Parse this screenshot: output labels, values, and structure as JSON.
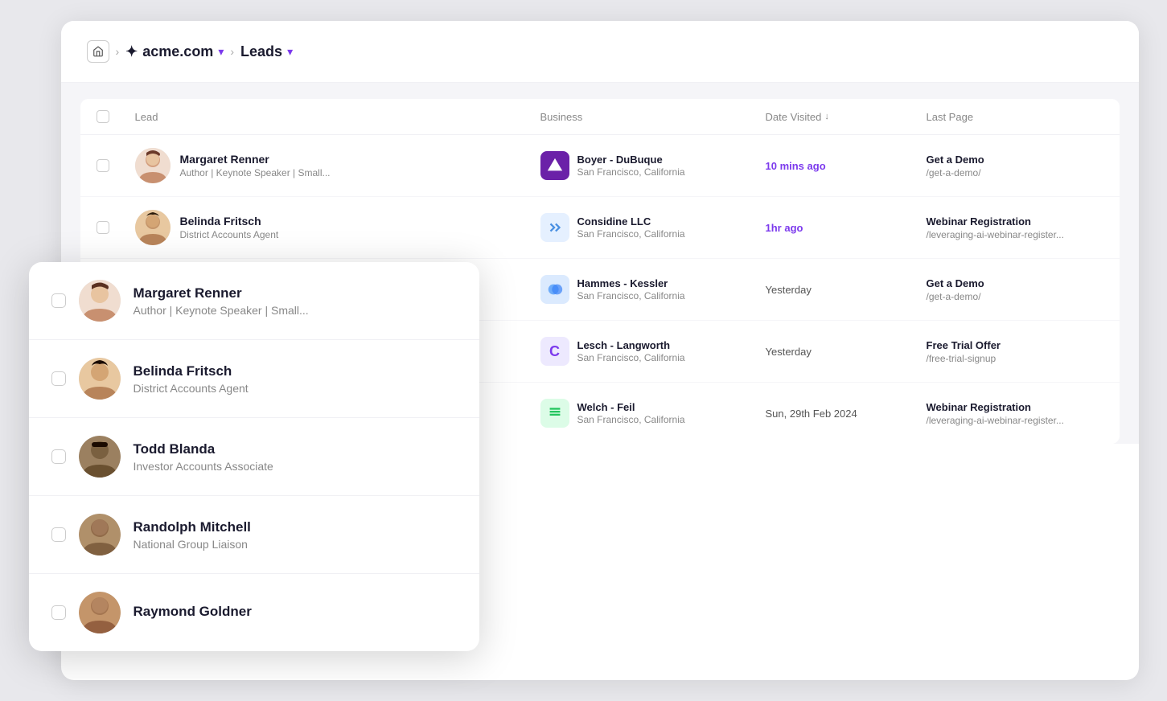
{
  "breadcrumb": {
    "home_icon": "⌂",
    "separator": ">",
    "company_name": "acme.com",
    "company_chevron": "▾",
    "page_name": "Leads",
    "page_chevron": "▾"
  },
  "table": {
    "columns": [
      {
        "id": "checkbox",
        "label": ""
      },
      {
        "id": "lead",
        "label": "Lead"
      },
      {
        "id": "business",
        "label": "Business"
      },
      {
        "id": "date_visited",
        "label": "Date Visited",
        "sortable": true
      },
      {
        "id": "last_page",
        "label": "Last Page"
      }
    ],
    "rows": [
      {
        "lead_name": "Margaret Renner",
        "lead_title": "Author | Keynote Speaker | Small...",
        "avatar_color": "#f5e6d8",
        "business_name": "Boyer - DuBuque",
        "business_location": "San Francisco, California",
        "business_logo_color": "#6b21a8",
        "business_logo_icon": "◆",
        "date_visited": "10 mins ago",
        "date_highlight": true,
        "last_page_label": "Get a Demo",
        "last_page_url": "/get-a-demo/"
      },
      {
        "lead_name": "Belinda Fritsch",
        "lead_title": "District Accounts Agent",
        "avatar_color": "#d4a574",
        "business_name": "Considine LLC",
        "business_location": "San Francisco, California",
        "business_logo_color": "#e5f0ff",
        "business_logo_icon": "⚡",
        "date_visited": "1hr ago",
        "date_highlight": true,
        "last_page_label": "Webinar Registration",
        "last_page_url": "/leveraging-ai-webinar-register..."
      },
      {
        "lead_name": "Todd Blanda",
        "lead_title": "Investor Accounts Associate",
        "avatar_color": "#8B6914",
        "business_name": "Hammes - Kessler",
        "business_location": "San Francisco, California",
        "business_logo_color": "#dbeafe",
        "business_logo_icon": "●",
        "date_visited": "Yesterday",
        "date_highlight": false,
        "last_page_label": "Get a Demo",
        "last_page_url": "/get-a-demo/"
      },
      {
        "lead_name": "Randolph Mitchell",
        "lead_title": "National Group Liaison",
        "avatar_color": "#9B8060",
        "business_name": "Lesch - Langworth",
        "business_location": "San Francisco, California",
        "business_logo_color": "#ede9fe",
        "business_logo_icon": "C",
        "date_visited": "Yesterday",
        "date_highlight": false,
        "last_page_label": "Free Trial Offer",
        "last_page_url": "/free-trial-signup"
      },
      {
        "lead_name": "Raymond Goldner",
        "lead_title": "",
        "avatar_color": "#c4956a",
        "business_name": "Welch - Feil",
        "business_location": "San Francisco, California",
        "business_logo_color": "#dcfce7",
        "business_logo_icon": "≋",
        "date_visited": "Sun, 29th Feb 2024",
        "date_highlight": false,
        "last_page_label": "Webinar Registration",
        "last_page_url": "/leveraging-ai-webinar-register..."
      }
    ]
  },
  "floating_panel": {
    "rows": [
      {
        "name": "Margaret Renner",
        "title": "Author | Keynote Speaker | Small...",
        "avatar_key": "margaret"
      },
      {
        "name": "Belinda Fritsch",
        "title": "District Accounts Agent",
        "avatar_key": "belinda"
      },
      {
        "name": "Todd Blanda",
        "title": "Investor Accounts Associate",
        "avatar_key": "todd"
      },
      {
        "name": "Randolph Mitchell",
        "title": "National Group Liaison",
        "avatar_key": "randolph"
      },
      {
        "name": "Raymond Goldner",
        "title": "",
        "avatar_key": "raymond"
      }
    ]
  }
}
